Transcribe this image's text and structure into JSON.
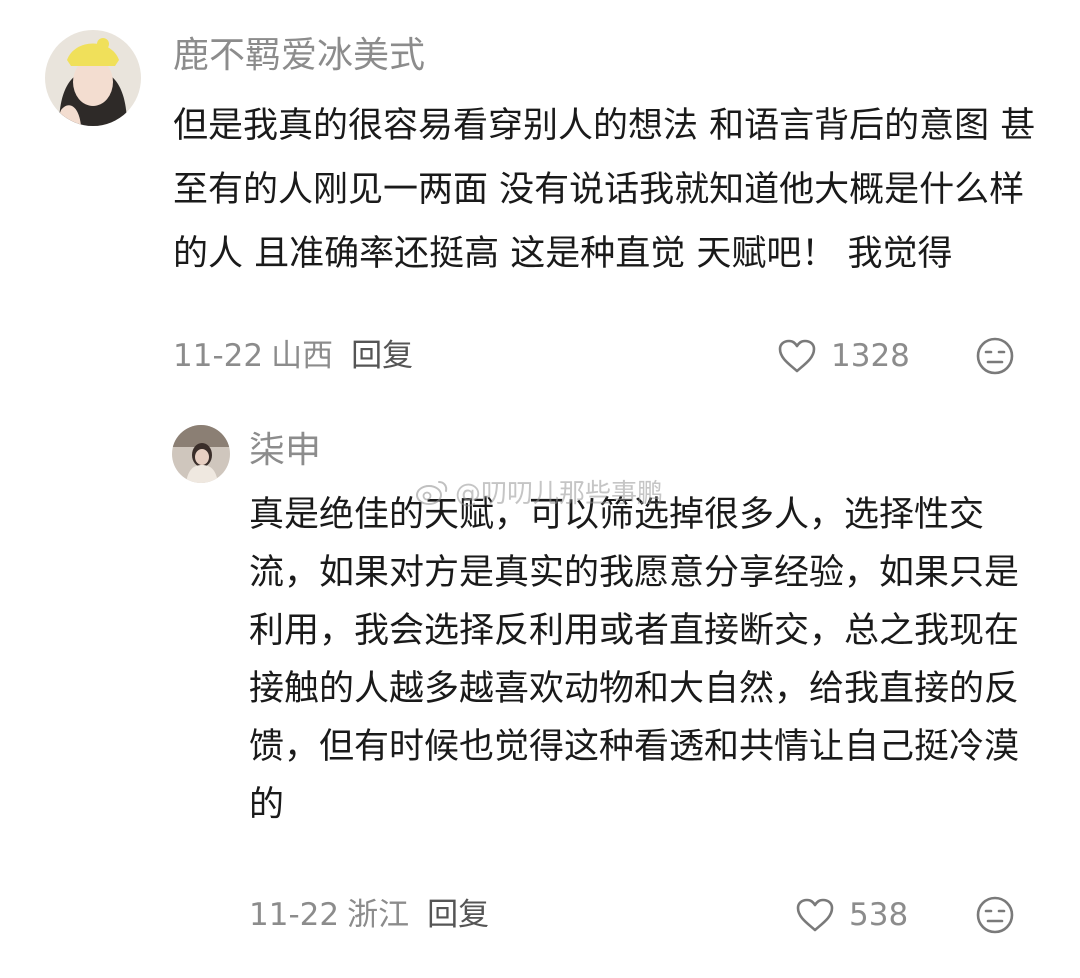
{
  "comments": [
    {
      "username": "鹿不羁爱冰美式",
      "text": "但是我真的很容易看穿别人的想法 和语言背后的意图 甚至有的人刚见一两面 没有说话我就知道他大概是什么样的人 且准确率还挺高 这是种直觉 天赋吧！ 我觉得",
      "date": "11-22",
      "location": "山西",
      "reply_label": "回复",
      "likes": "1328"
    },
    {
      "username": "柒申",
      "text": "真是绝佳的天赋，可以筛选掉很多人，选择性交流，如果对方是真实的我愿意分享经验，如果只是利用，我会选择反利用或者直接断交，总之我现在接触的人越多越喜欢动物和大自然，给我直接的反馈，但有时候也觉得这种看透和共情让自己挺冷漠的",
      "date": "11-22",
      "location": "浙江",
      "reply_label": "回复",
      "likes": "538"
    }
  ],
  "watermark": "@叨叨儿那些事鹏",
  "icons": {
    "like": "heart-outline-icon",
    "reaction": "neutral-face-icon",
    "watermark": "weibo-logo-icon"
  },
  "colors": {
    "text": "#1a1a1a",
    "muted": "#8c8c8c",
    "reply": "#555555"
  }
}
